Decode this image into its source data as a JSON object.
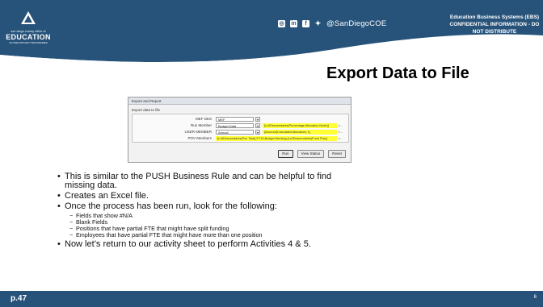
{
  "header": {
    "logo": {
      "small_text": "san diego county office of",
      "big_text": "EDUCATION",
      "tagline": "FUTURE WITHOUT BOUNDARIES"
    },
    "social_icons": [
      "instagram-icon",
      "linkedin-icon",
      "facebook-icon",
      "twitter-icon"
    ],
    "handle": "@SanDiegoCOE",
    "systems_line1": "Education Business Systems (EBS)",
    "systems_line2": "CONFIDENTIAL INFORMATION - DO NOT DISTRIBUTE"
  },
  "title": "Export Data to File",
  "screenshot": {
    "header": "Export and Report",
    "subtitle": "Export data to file",
    "fields": [
      {
        "label": "MEF DES",
        "value": "MEF",
        "note": ""
      },
      {
        "label": "Run Member",
        "value": "Budget Data",
        "note": "[Lv0Descendants(Percentage Allocation Node)]"
      },
      {
        "label": "USER MEMBER",
        "value": "Annual",
        "note": "[Account(Calculated Allocation) 1]"
      },
      {
        "label": "POV Members",
        "value": "",
        "note": "[Lv0Descendants(Pos Total),FY19,Budget,Working,[Lv0Descendants(Fund Pos)]"
      }
    ],
    "buttons": [
      "Run",
      "View Status",
      "Reset"
    ]
  },
  "bullets": [
    {
      "text": "This is similar to the PUSH Business Rule and can be helpful to find"
    },
    {
      "text": "missing data."
    },
    {
      "text": "Creates an Excel file."
    },
    {
      "text": "Once the process has been run, look for the following:"
    }
  ],
  "sub_bullets": [
    "Fields that show #N/A",
    "Blank Fields",
    "Positions that have partial FTE that might have split funding",
    "Employees that have partial FTE that might have more than one position"
  ],
  "last_bullet": "Now let’s return to our activity sheet to perform Activities 4 & 5.",
  "page_ref": "p.47",
  "slide_number": "6",
  "colors": {
    "brand": "#27537a",
    "highlight": "#ffff33"
  }
}
